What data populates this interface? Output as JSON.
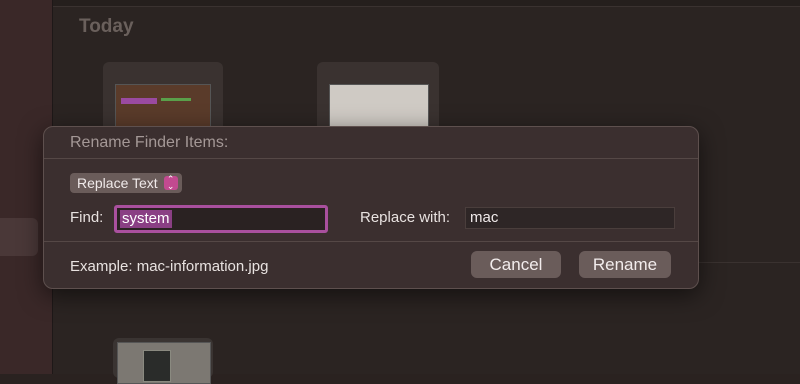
{
  "background": {
    "section_title": "Today"
  },
  "dialog": {
    "title": "Rename Finder Items:",
    "mode_popup": {
      "selected": "Replace Text",
      "arrows": "⌃⌄"
    },
    "find": {
      "label": "Find:",
      "value": "system"
    },
    "replace": {
      "label": "Replace with:",
      "value": "mac"
    },
    "example": "Example: mac-information.jpg",
    "buttons": {
      "cancel": "Cancel",
      "rename": "Rename"
    }
  },
  "colors": {
    "accent": "#c24a90",
    "focus_ring": "#a9509e",
    "dialog_bg": "#3b2f2f",
    "button_bg": "#6a5c5a"
  }
}
